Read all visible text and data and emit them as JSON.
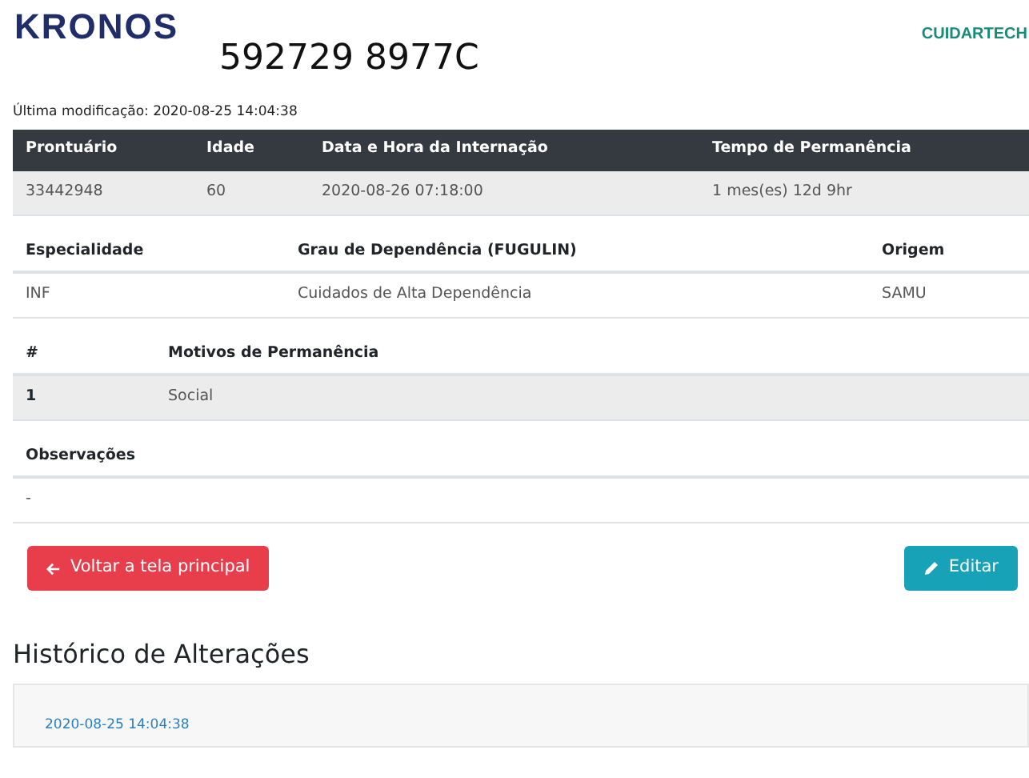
{
  "header": {
    "logo": "KRONOS",
    "brand": "CUIDARTECH",
    "record_title": "592729 8977C",
    "last_modified": "Última modificação: 2020-08-25 14:04:38"
  },
  "tables": [
    {
      "dark_header": true,
      "shaded_rows": true,
      "columns": [
        "Prontuário",
        "Idade",
        "Data e Hora da Internação",
        "Tempo de Permanência"
      ],
      "rows": [
        [
          "33442948",
          "60",
          "2020-08-26 07:18:00",
          "1 mes(es) 12d 9hr"
        ]
      ]
    },
    {
      "dark_header": false,
      "shaded_rows": false,
      "columns": [
        "Especialidade",
        "Grau de Dependência (FUGULIN)",
        "Origem"
      ],
      "rows": [
        [
          "INF",
          "Cuidados de Alta Dependência",
          "SAMU"
        ]
      ]
    },
    {
      "dark_header": false,
      "shaded_rows": true,
      "columns": [
        "#",
        "Motivos de Permanência"
      ],
      "rows": [
        [
          "1",
          "Social"
        ]
      ]
    },
    {
      "dark_header": false,
      "shaded_rows": false,
      "columns": [
        "Observações"
      ],
      "rows": [
        [
          "-"
        ]
      ]
    }
  ],
  "buttons": {
    "back": "Voltar a tela principal",
    "edit": "Editar"
  },
  "history": {
    "title": "Histórico de Alterações",
    "entries": [
      "2020-08-25 14:04:38"
    ]
  }
}
